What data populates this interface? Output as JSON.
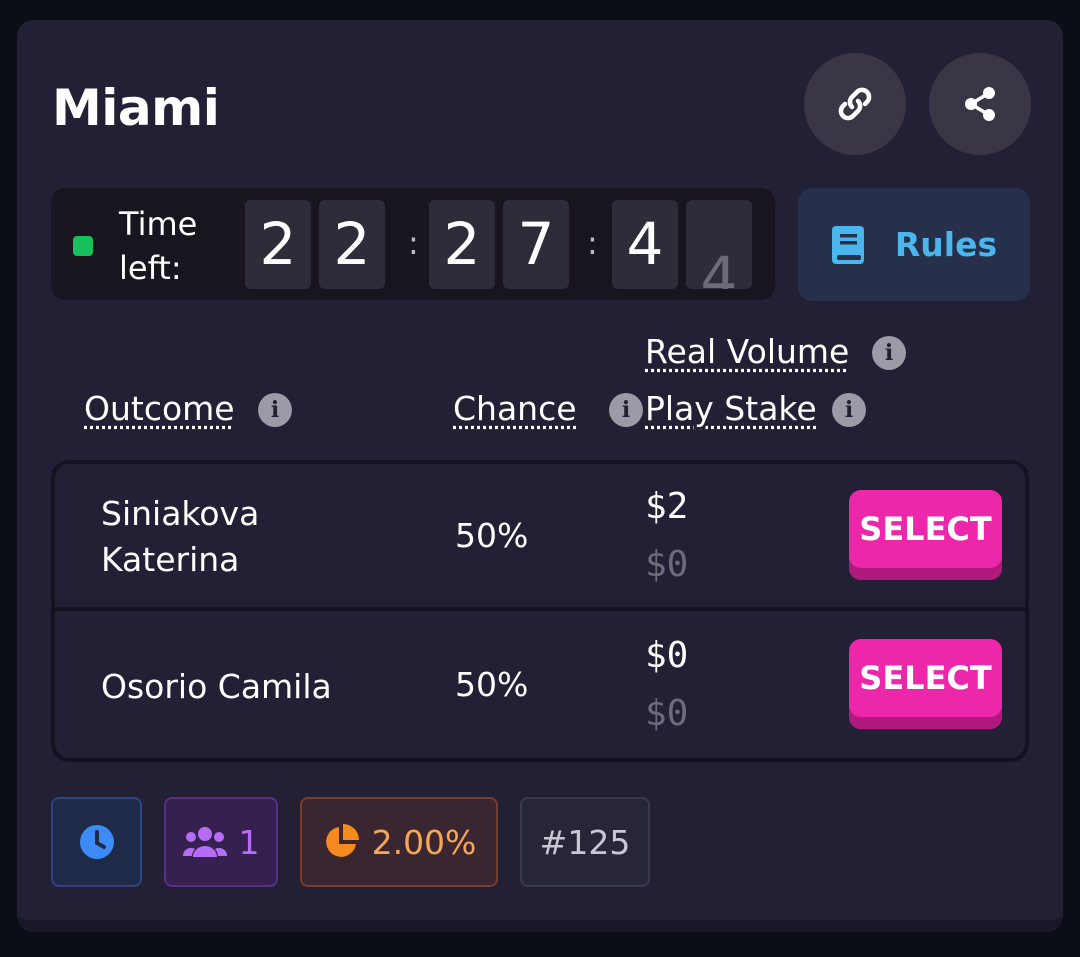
{
  "title": "Miami",
  "icons": {
    "link": "link-icon",
    "share": "share-icon",
    "rules": "book-icon",
    "clock": "clock-icon",
    "users": "users-icon",
    "pie": "pie-chart-icon"
  },
  "timer": {
    "label_line1": "Time",
    "label_line2": "left:",
    "digits": [
      "2",
      "2",
      "2",
      "7",
      "4",
      ""
    ],
    "partial_digit": "4",
    "separator": ":"
  },
  "rules_label": "Rules",
  "headers": {
    "outcome": "Outcome",
    "chance": "Chance",
    "real_volume": "Real Volume",
    "play_stake": "Play Stake"
  },
  "outcomes": [
    {
      "name_line1": "Siniakova",
      "name_line2": "Katerina",
      "chance": "50%",
      "real_volume": "$2",
      "play_stake": "$0",
      "action": "SELECT"
    },
    {
      "name_line1": "Osorio Camila",
      "name_line2": "",
      "chance": "50%",
      "real_volume": "$0",
      "play_stake": "$0",
      "action": "SELECT"
    }
  ],
  "footer": {
    "participants": "1",
    "fee": "2.00%",
    "market_id": "#125"
  },
  "colors": {
    "accent_pink": "#ec27a9",
    "rules_blue": "#4bb6ee",
    "timer_green": "#14c15a",
    "fee_orange": "#f58a1f",
    "users_purple": "#b66df5",
    "clock_blue": "#3b8cf6"
  }
}
